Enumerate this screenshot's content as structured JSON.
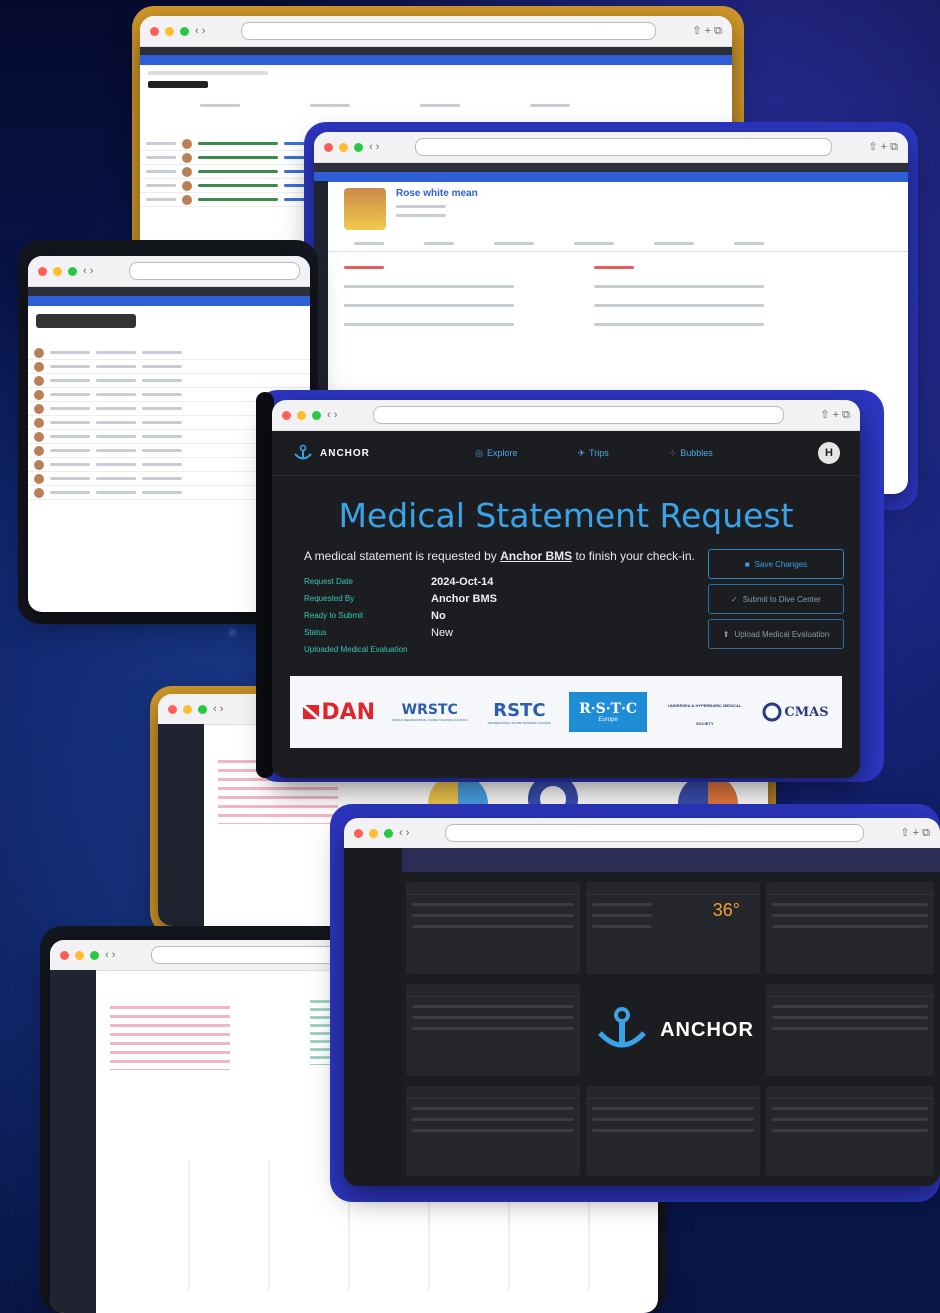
{
  "main_window": {
    "brand": "ANCHOR",
    "nav": [
      {
        "label": "Explore",
        "icon": "compass-icon"
      },
      {
        "label": "Trips",
        "icon": "fins-icon"
      },
      {
        "label": "Bubbles",
        "icon": "bubbles-icon"
      }
    ],
    "avatar_initial": "H",
    "title": "Medical Statement Request",
    "intro_prefix": "A medical statement is requested by ",
    "intro_center": "Anchor BMS",
    "intro_suffix": " to finish your check-in.",
    "fields": [
      {
        "label": "Request Date",
        "value": "2024-Oct-14"
      },
      {
        "label": "Requested By",
        "value": "Anchor BMS"
      },
      {
        "label": "Ready to Submit",
        "value": "No"
      },
      {
        "label": "Status",
        "value": "New"
      },
      {
        "label": "Uploaded Medical Evaluation",
        "value": ""
      }
    ],
    "buttons": {
      "save": "Save Changes",
      "submit": "Submit to Dive Center",
      "upload": "Upload Medical Evaluation"
    },
    "logos": [
      "DAN",
      "WRSTC",
      "RSTC",
      "R·S·T·C",
      "UNDERSEA & HYPERBARIC MEDICAL SOCIETY",
      "CMAS"
    ],
    "logo_sub": {
      "wrstc": "WORLD RECREATIONAL SCUBA TRAINING COUNCIL",
      "rstc": "RECREATIONAL SCUBA TRAINING COUNCIL",
      "rstc_eu": "Europe"
    }
  },
  "profile_window": {
    "name": "Rose white mean"
  },
  "dashboard_window": {
    "brand": "ANCHOR",
    "temperature": "36°"
  },
  "colors": {
    "accent": "#3aa3e8",
    "field_label": "#35c8b4",
    "frame_gold": "#d39a2a",
    "frame_blue": "#2d37c4"
  }
}
